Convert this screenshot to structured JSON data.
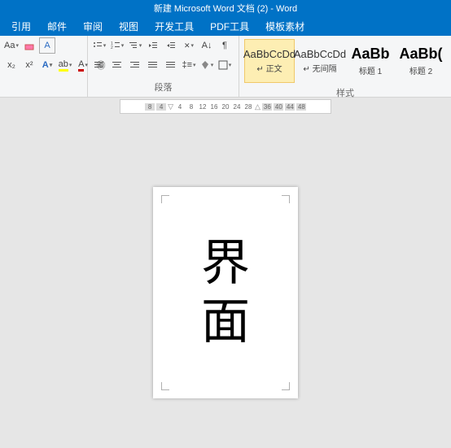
{
  "title": "新建 Microsoft Word 文档 (2) - Word",
  "tabs": [
    "引用",
    "邮件",
    "审阅",
    "视图",
    "开发工具",
    "PDF工具",
    "模板素材"
  ],
  "paragraph_label": "段落",
  "styles_label": "样式",
  "styles": [
    {
      "preview": "AaBbCcDd",
      "name": "↵ 正文",
      "big": false,
      "sel": true
    },
    {
      "preview": "AaBbCcDd",
      "name": "↵ 无间隔",
      "big": false,
      "sel": false
    },
    {
      "preview": "AaBb",
      "name": "标题 1",
      "big": true,
      "sel": false
    },
    {
      "preview": "AaBb(",
      "name": "标题 2",
      "big": true,
      "sel": false
    }
  ],
  "ruler": [
    "8",
    "4",
    "",
    "4",
    "8",
    "12",
    "16",
    "20",
    "24",
    "28",
    "",
    "36",
    "40",
    "44",
    "48"
  ],
  "doc_text": [
    "界",
    "面"
  ]
}
